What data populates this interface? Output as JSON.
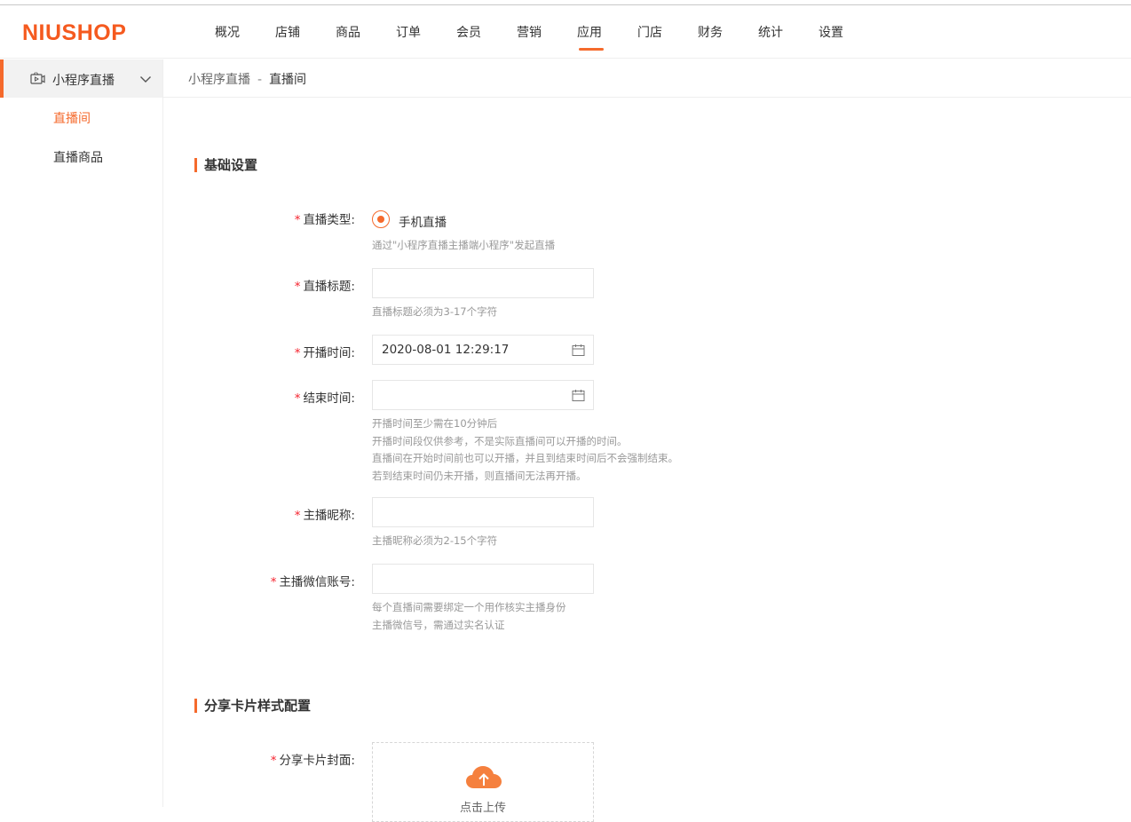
{
  "brand": {
    "logo": "NIUSHOP",
    "accent": "#f56a2c"
  },
  "nav": {
    "items": [
      "概况",
      "店铺",
      "商品",
      "订单",
      "会员",
      "营销",
      "应用",
      "门店",
      "财务",
      "统计",
      "设置"
    ],
    "active": "应用"
  },
  "sidebar": {
    "group_label": "小程序直播",
    "group_icon": "video-camera-icon",
    "items": [
      {
        "label": "直播间",
        "active": true
      },
      {
        "label": "直播商品",
        "active": false
      }
    ]
  },
  "breadcrumb": {
    "parent": "小程序直播",
    "separator": "-",
    "current": "直播间"
  },
  "sections": {
    "basic": "基础设置",
    "share": "分享卡片样式配置"
  },
  "form": {
    "live_type": {
      "label": "直播类型:",
      "option": "手机直播",
      "hint": "通过\"小程序直播主播端小程序\"发起直播"
    },
    "title": {
      "label": "直播标题:",
      "value": "",
      "hint": "直播标题必须为3-17个字符"
    },
    "start_time": {
      "label": "开播时间:",
      "value": "2020-08-01 12:29:17"
    },
    "end_time": {
      "label": "结束时间:",
      "value": "",
      "hints": [
        "开播时间至少需在10分钟后",
        "开播时间段仅供参考，不是实际直播间可以开播的时间。",
        "直播间在开始时间前也可以开播，并且到结束时间后不会强制结束。",
        "若到结束时间仍未开播，则直播间无法再开播。"
      ]
    },
    "anchor_name": {
      "label": "主播昵称:",
      "value": "",
      "hint": "主播昵称必须为2-15个字符"
    },
    "anchor_wechat": {
      "label": "主播微信账号:",
      "value": "",
      "hints": [
        "每个直播间需要绑定一个用作核实主播身份",
        "主播微信号，需通过实名认证"
      ]
    },
    "share_cover": {
      "label": "分享卡片封面:",
      "upload_text": "点击上传"
    }
  }
}
